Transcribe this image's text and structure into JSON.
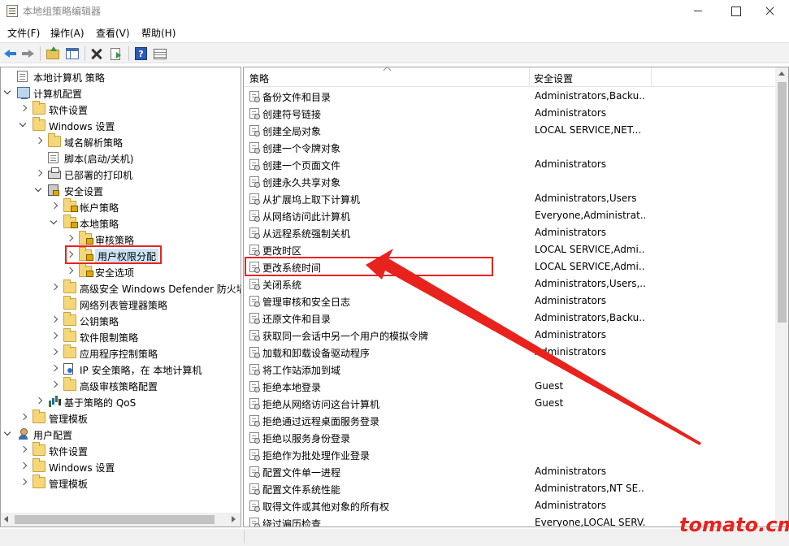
{
  "window": {
    "title": "本地组策略编辑器"
  },
  "menu": [
    "文件(F)",
    "操作(A)",
    "查看(V)",
    "帮助(H)"
  ],
  "tree": {
    "items": [
      {
        "label": "本地计算机 策略",
        "icon": "policy-icon",
        "level": 0,
        "toggle": "none"
      },
      {
        "label": "计算机配置",
        "icon": "computer-icon",
        "level": 0,
        "toggle": "open"
      },
      {
        "label": "软件设置",
        "icon": "folder-icon",
        "level": 1,
        "toggle": "closed"
      },
      {
        "label": "Windows 设置",
        "icon": "folder-icon",
        "level": 1,
        "toggle": "open"
      },
      {
        "label": "域名解析策略",
        "icon": "folder-icon",
        "level": 2,
        "toggle": "closed"
      },
      {
        "label": "脚本(启动/关机)",
        "icon": "document-icon",
        "level": 2,
        "toggle": "none"
      },
      {
        "label": "已部署的打印机",
        "icon": "printer-icon",
        "level": 2,
        "toggle": "closed"
      },
      {
        "label": "安全设置",
        "icon": "security-icon",
        "level": 2,
        "toggle": "open"
      },
      {
        "label": "帐户策略",
        "icon": "lock-folder-icon",
        "level": 3,
        "toggle": "closed"
      },
      {
        "label": "本地策略",
        "icon": "lock-folder-icon",
        "level": 3,
        "toggle": "open"
      },
      {
        "label": "审核策略",
        "icon": "lock-folder-icon",
        "level": 4,
        "toggle": "closed"
      },
      {
        "label": "用户权限分配",
        "icon": "lock-folder-icon",
        "level": 4,
        "toggle": "closed",
        "selected": true
      },
      {
        "label": "安全选项",
        "icon": "lock-folder-icon",
        "level": 4,
        "toggle": "closed"
      },
      {
        "label": "高级安全 Windows Defender 防火墙",
        "icon": "folder-icon",
        "level": 3,
        "toggle": "closed"
      },
      {
        "label": "网络列表管理器策略",
        "icon": "folder-icon",
        "level": 3,
        "toggle": "none"
      },
      {
        "label": "公钥策略",
        "icon": "folder-icon",
        "level": 3,
        "toggle": "closed"
      },
      {
        "label": "软件限制策略",
        "icon": "folder-icon",
        "level": 3,
        "toggle": "closed"
      },
      {
        "label": "应用程序控制策略",
        "icon": "folder-icon",
        "level": 3,
        "toggle": "closed"
      },
      {
        "label": "IP 安全策略，在 本地计算机",
        "icon": "ipsec-icon",
        "level": 3,
        "toggle": "closed"
      },
      {
        "label": "高级审核策略配置",
        "icon": "folder-icon",
        "level": 3,
        "toggle": "closed"
      },
      {
        "label": "基于策略的 QoS",
        "icon": "chart-icon",
        "level": 2,
        "toggle": "closed"
      },
      {
        "label": "管理模板",
        "icon": "folder-icon",
        "level": 1,
        "toggle": "closed"
      },
      {
        "label": "用户配置",
        "icon": "user-icon",
        "level": 0,
        "toggle": "open"
      },
      {
        "label": "软件设置",
        "icon": "folder-icon",
        "level": 1,
        "toggle": "closed"
      },
      {
        "label": "Windows 设置",
        "icon": "folder-icon",
        "level": 1,
        "toggle": "closed"
      },
      {
        "label": "管理模板",
        "icon": "folder-icon",
        "level": 1,
        "toggle": "closed"
      }
    ]
  },
  "list": {
    "columns": [
      "策略",
      "安全设置"
    ],
    "rows": [
      {
        "policy": "备份文件和目录",
        "setting": "Administrators,Backu..."
      },
      {
        "policy": "创建符号链接",
        "setting": "Administrators"
      },
      {
        "policy": "创建全局对象",
        "setting": "LOCAL SERVICE,NET..."
      },
      {
        "policy": "创建一个令牌对象",
        "setting": ""
      },
      {
        "policy": "创建一个页面文件",
        "setting": "Administrators"
      },
      {
        "policy": "创建永久共享对象",
        "setting": ""
      },
      {
        "policy": "从扩展坞上取下计算机",
        "setting": "Administrators,Users"
      },
      {
        "policy": "从网络访问此计算机",
        "setting": "Everyone,Administrat..."
      },
      {
        "policy": "从远程系统强制关机",
        "setting": "Administrators"
      },
      {
        "policy": "更改时区",
        "setting": "LOCAL SERVICE,Admi..."
      },
      {
        "policy": "更改系统时间",
        "setting": "LOCAL SERVICE,Admi..."
      },
      {
        "policy": "关闭系统",
        "setting": "Administrators,Users,..."
      },
      {
        "policy": "管理审核和安全日志",
        "setting": "Administrators"
      },
      {
        "policy": "还原文件和目录",
        "setting": "Administrators,Backu..."
      },
      {
        "policy": "获取同一会话中另一个用户的模拟令牌",
        "setting": "Administrators"
      },
      {
        "policy": "加载和卸载设备驱动程序",
        "setting": "Administrators"
      },
      {
        "policy": "将工作站添加到域",
        "setting": ""
      },
      {
        "policy": "拒绝本地登录",
        "setting": "Guest"
      },
      {
        "policy": "拒绝从网络访问这台计算机",
        "setting": "Guest"
      },
      {
        "policy": "拒绝通过远程桌面服务登录",
        "setting": ""
      },
      {
        "policy": "拒绝以服务身份登录",
        "setting": ""
      },
      {
        "policy": "拒绝作为批处理作业登录",
        "setting": ""
      },
      {
        "policy": "配置文件单一进程",
        "setting": "Administrators"
      },
      {
        "policy": "配置文件系统性能",
        "setting": "Administrators,NT SE..."
      },
      {
        "policy": "取得文件或其他对象的所有权",
        "setting": "Administrators"
      },
      {
        "policy": "绕过遍历检查",
        "setting": "Everyone,LOCAL SERV..."
      }
    ]
  },
  "annotation": {
    "color": "#e8231e",
    "watermark": "tomato.cm"
  }
}
